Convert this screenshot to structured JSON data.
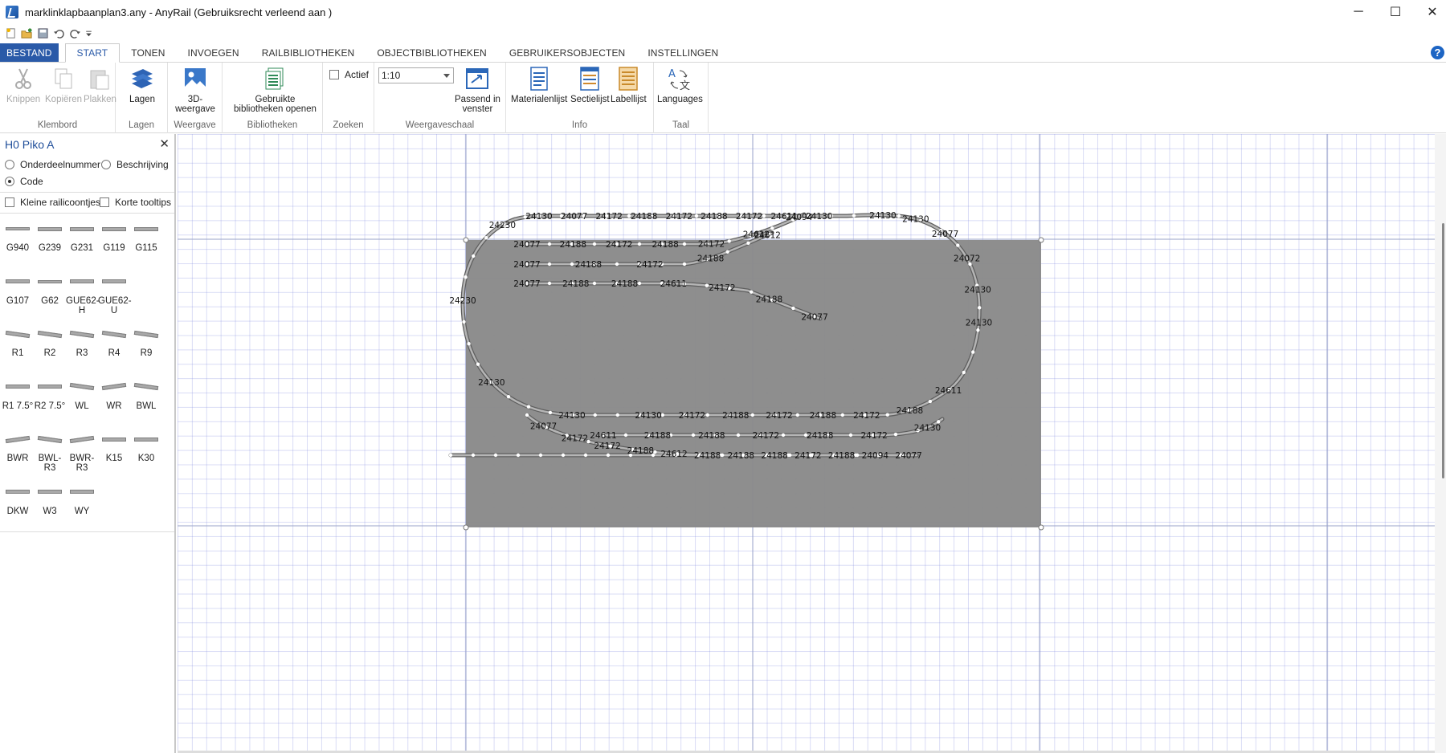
{
  "window": {
    "title": "marklinklapbaanplan3.any - AnyRail (Gebruiksrecht verleend aan )",
    "minimize": "─",
    "maximize": "☐",
    "close": "✕"
  },
  "quick_access": [
    "new-icon",
    "open-icon",
    "save-icon",
    "undo-icon",
    "redo-icon",
    "customize-icon"
  ],
  "tabs": [
    {
      "label": "BESTAND"
    },
    {
      "label": "START"
    },
    {
      "label": "TONEN"
    },
    {
      "label": "INVOEGEN"
    },
    {
      "label": "RAILBIBLIOTHEKEN"
    },
    {
      "label": "OBJECTBIBLIOTHEKEN"
    },
    {
      "label": "GEBRUIKERSOBJECTEN"
    },
    {
      "label": "INSTELLINGEN"
    }
  ],
  "help": "?",
  "ribbon": {
    "klembord": {
      "label": "Klembord",
      "cut": "Knippen",
      "copy": "Kopiëren",
      "paste": "Plakken"
    },
    "lagen": {
      "label": "Lagen",
      "layers": "Lagen"
    },
    "weergave": {
      "label": "Weergave",
      "view3d": "3D-weergave"
    },
    "bibliotheken": {
      "label": "Bibliotheken",
      "open_line1": "Gebruikte",
      "open_line2": "bibliotheken openen"
    },
    "zoeken": {
      "label": "Zoeken",
      "active": "Actief"
    },
    "schaal": {
      "label": "Weergaveschaal",
      "scale_value": "1:10",
      "fit_line1": "Passend in",
      "fit_line2": "venster"
    },
    "info": {
      "label": "Info",
      "materials": "Materialenlijst",
      "sections": "Sectielijst",
      "labels": "Labellijst"
    },
    "taal": {
      "label": "Taal",
      "languages": "Languages"
    }
  },
  "panel": {
    "title": "H0 Piko A",
    "close": "✕",
    "radio_part": "Onderdeelnummer",
    "radio_desc": "Beschrijving",
    "radio_code": "Code",
    "chk_small": "Kleine railicoontjes",
    "chk_tooltips": "Korte tooltips",
    "parts": [
      "G940",
      "G239",
      "G231",
      "G119",
      "G115",
      "G107",
      "G62",
      "GUE62-H",
      "GUE62-U",
      "R1",
      "R2",
      "R3",
      "R4",
      "R9",
      "R1 7.5°",
      "R2 7.5°",
      "WL",
      "WR",
      "BWL",
      "BWR",
      "BWL-R3",
      "BWR-R3",
      "K15",
      "K30",
      "DKW",
      "W3",
      "WY"
    ]
  },
  "layout": {
    "labels": {
      "top": [
        "24130",
        "24077",
        "24172",
        "24188",
        "24172",
        "24188",
        "24172",
        "24611",
        "24130"
      ],
      "siding1": [
        "24077",
        "24188",
        "24172",
        "24188",
        "24172",
        "24612",
        "24094"
      ],
      "siding2": [
        "24077",
        "24188",
        "24172",
        "24188",
        "24612"
      ],
      "siding3": [
        "24077",
        "24188",
        "24188",
        "24611",
        "24172",
        "24188",
        "24077"
      ],
      "left": [
        "24130",
        "24130",
        "24230",
        "24230"
      ],
      "right": [
        "24130",
        "24130",
        "24077",
        "24072",
        "24130",
        "24130"
      ],
      "bottom1": [
        "24611",
        "24188",
        "24172",
        "24188",
        "24172",
        "24188",
        "24172",
        "24130"
      ],
      "bottom2": [
        "24611",
        "24188",
        "24188",
        "24172",
        "24188",
        "24172",
        "24130"
      ],
      "bottom3": [
        "24077",
        "24172",
        "24172",
        "24188",
        "24612",
        "24188",
        "24188",
        "24188",
        "24172",
        "24188",
        "24094",
        "24077"
      ]
    }
  }
}
